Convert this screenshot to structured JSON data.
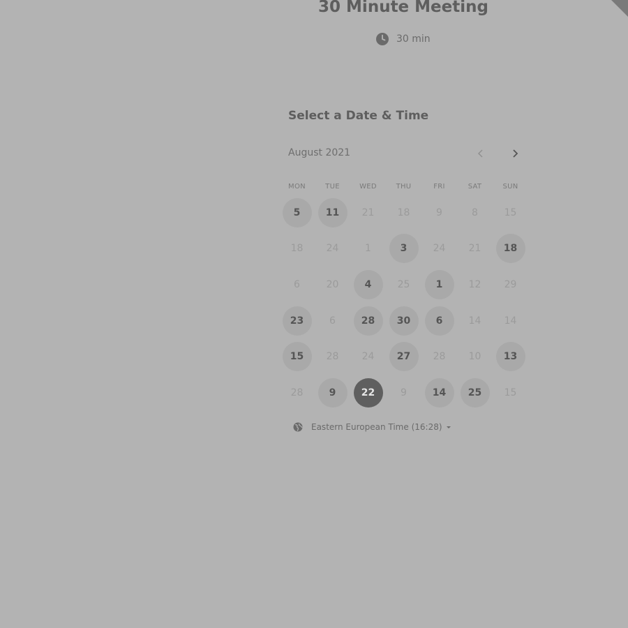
{
  "event": {
    "title": "30 Minute Meeting",
    "duration": "30 min",
    "clock_icon": "clock-icon"
  },
  "scheduler": {
    "heading": "Select a Date & Time",
    "month": "August 2021",
    "prev_icon": "chevron-left-icon",
    "next_icon": "chevron-right-icon",
    "weekdays": [
      "MON",
      "TUE",
      "WED",
      "THU",
      "FRI",
      "SAT",
      "SUN"
    ],
    "days": [
      {
        "label": "5",
        "state": "available"
      },
      {
        "label": "11",
        "state": "available"
      },
      {
        "label": "21",
        "state": "disabled"
      },
      {
        "label": "18",
        "state": "disabled"
      },
      {
        "label": "9",
        "state": "disabled"
      },
      {
        "label": "8",
        "state": "disabled"
      },
      {
        "label": "15",
        "state": "disabled"
      },
      {
        "label": "18",
        "state": "disabled"
      },
      {
        "label": "24",
        "state": "disabled"
      },
      {
        "label": "1",
        "state": "disabled"
      },
      {
        "label": "3",
        "state": "available"
      },
      {
        "label": "24",
        "state": "disabled"
      },
      {
        "label": "21",
        "state": "disabled"
      },
      {
        "label": "18",
        "state": "available"
      },
      {
        "label": "6",
        "state": "disabled"
      },
      {
        "label": "20",
        "state": "disabled"
      },
      {
        "label": "4",
        "state": "available"
      },
      {
        "label": "25",
        "state": "disabled"
      },
      {
        "label": "1",
        "state": "available"
      },
      {
        "label": "12",
        "state": "disabled"
      },
      {
        "label": "29",
        "state": "disabled"
      },
      {
        "label": "23",
        "state": "available"
      },
      {
        "label": "6",
        "state": "disabled"
      },
      {
        "label": "28",
        "state": "available"
      },
      {
        "label": "30",
        "state": "available"
      },
      {
        "label": "6",
        "state": "available"
      },
      {
        "label": "14",
        "state": "disabled"
      },
      {
        "label": "14",
        "state": "disabled"
      },
      {
        "label": "15",
        "state": "available"
      },
      {
        "label": "28",
        "state": "disabled"
      },
      {
        "label": "24",
        "state": "disabled"
      },
      {
        "label": "27",
        "state": "available"
      },
      {
        "label": "28",
        "state": "disabled"
      },
      {
        "label": "10",
        "state": "disabled"
      },
      {
        "label": "13",
        "state": "available"
      },
      {
        "label": "28",
        "state": "disabled"
      },
      {
        "label": "9",
        "state": "available"
      },
      {
        "label": "22",
        "state": "selected"
      },
      {
        "label": "9",
        "state": "disabled"
      },
      {
        "label": "14",
        "state": "available"
      },
      {
        "label": "25",
        "state": "available"
      },
      {
        "label": "15",
        "state": "disabled"
      }
    ]
  },
  "timezone": {
    "label": "Eastern European Time (16:28)",
    "icon": "globe-icon"
  },
  "colors": {
    "background": "#b3b3b3",
    "available_day": "#a9a9a9",
    "selected_day": "#5f5f5f"
  }
}
